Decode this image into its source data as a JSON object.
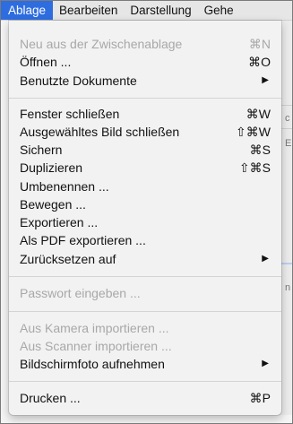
{
  "menubar": {
    "items": [
      "Ablage",
      "Bearbeiten",
      "Darstellung",
      "Gehe"
    ]
  },
  "background": {
    "fragments": [
      "c",
      "E",
      "n"
    ]
  },
  "menu": {
    "open_menu": "Ablage",
    "items": [
      {
        "label": "Neu aus der Zwischenablage",
        "shortcut": "⌘N",
        "enabled": false
      },
      {
        "label": "Öffnen ...",
        "shortcut": "⌘O",
        "enabled": true
      },
      {
        "label": "Benutzte Dokumente",
        "submenu_arrow": "▶",
        "enabled": true
      },
      {
        "label": "Fenster schließen",
        "shortcut": "⌘W",
        "enabled": true
      },
      {
        "label": "Ausgewähltes Bild schließen",
        "shortcut": "⇧⌘W",
        "enabled": true
      },
      {
        "label": "Sichern",
        "shortcut": "⌘S",
        "enabled": true
      },
      {
        "label": "Duplizieren",
        "shortcut": "⇧⌘S",
        "enabled": true
      },
      {
        "label": "Umbenennen ...",
        "enabled": true
      },
      {
        "label": "Bewegen ...",
        "enabled": true
      },
      {
        "label": "Exportieren ...",
        "enabled": true
      },
      {
        "label": "Als PDF exportieren ...",
        "enabled": true
      },
      {
        "label": "Zurücksetzen auf",
        "submenu_arrow": "▶",
        "enabled": true
      },
      {
        "label": "Passwort eingeben ...",
        "enabled": false
      },
      {
        "label": "Aus Kamera importieren ...",
        "enabled": false
      },
      {
        "label": "Aus Scanner importieren ...",
        "enabled": false
      },
      {
        "label": "Bildschirmfoto aufnehmen",
        "submenu_arrow": "▶",
        "enabled": true
      },
      {
        "label": "Drucken ...",
        "shortcut": "⌘P",
        "enabled": true
      }
    ]
  }
}
